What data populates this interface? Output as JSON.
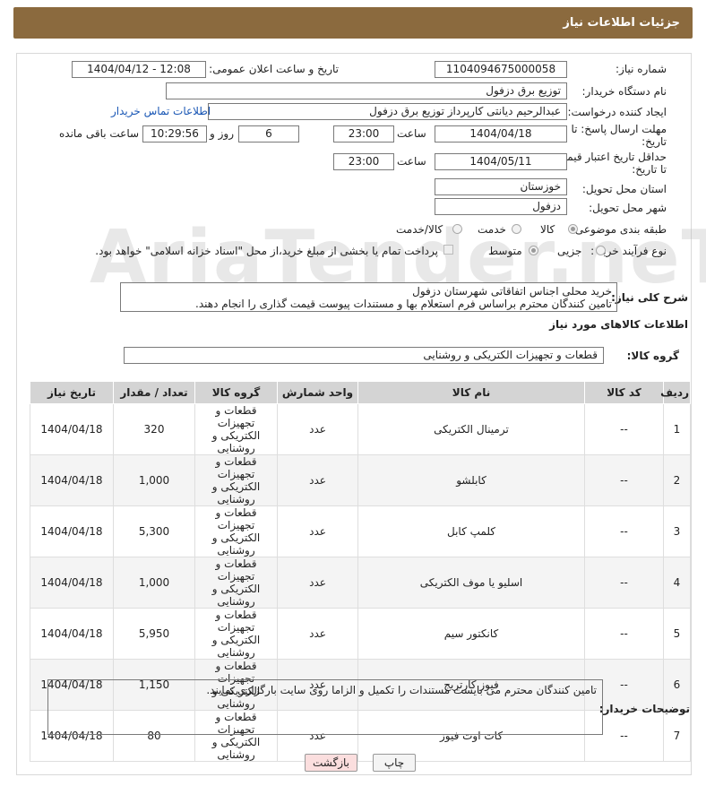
{
  "header": {
    "title": "جزئیات اطلاعات نیاز"
  },
  "form": {
    "need_number_label": "شماره نیاز:",
    "need_number": "1104094675000058",
    "announce_label": "تاریخ و ساعت اعلان عمومی:",
    "announce_value": "1404/04/12 - 12:08",
    "buyer_org_label": "نام دستگاه خریدار:",
    "buyer_org": "توزیع برق دزفول",
    "creator_label": "ایجاد کننده درخواست:",
    "creator": "عبدالرحیم دیانتی کارپرداز توزیع برق دزفول",
    "contact_link": "اطلاعات تماس خریدار",
    "deadline_label_1": "مهلت ارسال پاسخ: تا",
    "deadline_label_2": "تاریخ:",
    "deadline_date": "1404/04/18",
    "time_label": "ساعت",
    "deadline_time": "23:00",
    "days_value": "6",
    "days_label": "روز و",
    "remaining_time": "10:29:56",
    "remaining_label": "ساعت باقی مانده",
    "validity_label_1": "حداقل تاریخ اعتبار قیمت:",
    "validity_label_2": "تا تاریخ:",
    "validity_date": "1404/05/11",
    "validity_time": "23:00",
    "province_label": "استان محل تحویل:",
    "province": "خوزستان",
    "city_label": "شهر محل تحویل:",
    "city": "دزفول",
    "category_label": "طبقه بندی موضوعی:",
    "category_options": [
      "کالا",
      "خدمت",
      "کالا/خدمت"
    ],
    "purchase_type_label": "نوع فرآیند خرید :",
    "purchase_options": [
      "جزیی",
      "متوسط"
    ],
    "payment_note": "پرداخت تمام یا بخشی از مبلغ خرید،از محل \"اسناد خزانه اسلامی\" خواهد بود.",
    "description_label": "شرح کلی نیاز:",
    "description_line1": "خرید محلی اجناس اتفاقاتی شهرستان دزفول",
    "description_line2": "تامین کنندگان محترم براساس فرم استعلام بها و مستندات پیوست قیمت گذاری را انجام دهند.",
    "goods_info_title": "اطلاعات کالاهای مورد نیاز",
    "goods_group_label": "گروه کالا:",
    "goods_group": "قطعات و تجهیزات الکتریکی و روشنایی"
  },
  "table": {
    "headers": [
      "ردیف",
      "کد کالا",
      "نام کالا",
      "واحد شمارش",
      "گروه کالا",
      "تعداد / مقدار",
      "تاریخ نیاز"
    ],
    "rows": [
      {
        "idx": "1",
        "code": "--",
        "name": "ترمینال الکتریکی",
        "unit": "عدد",
        "group": "قطعات و تجهیزات الکتریکی و روشنایی",
        "qty": "320",
        "date": "1404/04/18"
      },
      {
        "idx": "2",
        "code": "--",
        "name": "کابلشو",
        "unit": "عدد",
        "group": "قطعات و تجهیزات الکتریکی و روشنایی",
        "qty": "1,000",
        "date": "1404/04/18"
      },
      {
        "idx": "3",
        "code": "--",
        "name": "کلمپ کابل",
        "unit": "عدد",
        "group": "قطعات و تجهیزات الکتریکی و روشنایی",
        "qty": "5,300",
        "date": "1404/04/18"
      },
      {
        "idx": "4",
        "code": "--",
        "name": "اسلیو یا موف الکتریکی",
        "unit": "عدد",
        "group": "قطعات و تجهیزات الکتریکی و روشنایی",
        "qty": "1,000",
        "date": "1404/04/18"
      },
      {
        "idx": "5",
        "code": "--",
        "name": "کانکتور سیم",
        "unit": "عدد",
        "group": "قطعات و تجهیزات الکتریکی و روشنایی",
        "qty": "5,950",
        "date": "1404/04/18"
      },
      {
        "idx": "6",
        "code": "--",
        "name": "فیوز کارتریج",
        "unit": "عدد",
        "group": "قطعات و تجهیزات الکتریکی و روشنایی",
        "qty": "1,150",
        "date": "1404/04/18"
      },
      {
        "idx": "7",
        "code": "--",
        "name": "کات اوت فیوز",
        "unit": "عدد",
        "group": "قطعات و تجهیزات الکتریکی و روشنایی",
        "qty": "80",
        "date": "1404/04/18"
      }
    ]
  },
  "buyer_notes": {
    "label": "توضیحات خریدار:",
    "text": "تامین کنندگان محترم می بایست مستندات را تکمیل و الزاما روی سایت بارگزاری نمایند."
  },
  "buttons": {
    "print": "چاپ",
    "back": "بازگشت"
  },
  "watermark": "AriaTender.neT",
  "colors": {
    "titlebar": "#8b6a3e",
    "link": "#1a57b5",
    "back_button_bg": "#fbdede",
    "table_header": "#d4d4d4"
  }
}
